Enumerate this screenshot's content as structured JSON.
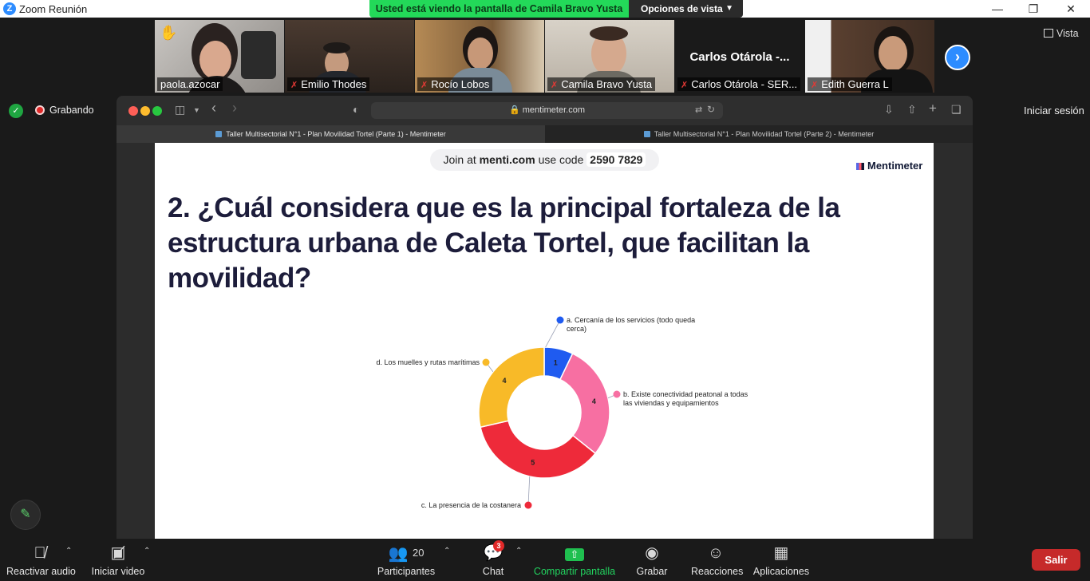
{
  "window": {
    "title": "Zoom Reunión",
    "logo_letter": "Z"
  },
  "share_banner": {
    "message": "Usted está viendo la pantalla de Camila Bravo Yusta",
    "view_options": "Opciones de vista"
  },
  "participants": [
    {
      "name": "paola.azocar",
      "muted": false,
      "hand_raised": true
    },
    {
      "name": "Emilio Thodes",
      "muted": true
    },
    {
      "name": "Rocío Lobos",
      "muted": true
    },
    {
      "name": "Camila Bravo Yusta",
      "muted": true
    },
    {
      "name": "Carlos Otárola - SER...",
      "muted": true,
      "display_name": "Carlos  Otárola  -..."
    },
    {
      "name": "Edith Guerra L",
      "muted": true
    }
  ],
  "view_label": "Vista",
  "recording_label": "Grabando",
  "signin_label": "Iniciar sesión",
  "browser": {
    "url": "mentimeter.com",
    "tabs": [
      "Taller Multisectorial N°1 - Plan Movilidad Tortel (Parte 1) - Mentimeter",
      "Taller Multisectorial N°1 - Plan Movilidad Tortel (Parte 2) - Mentimeter"
    ]
  },
  "menti": {
    "join_prefix": "Join at",
    "join_site": "menti.com",
    "join_mid": "use code",
    "join_code": "2590 7829",
    "brand": "Mentimeter",
    "question_lines": [
      "2. ¿Cuál considera que es la principal fortaleza de la",
      "estructura urbana de Caleta Tortel, que facilitan la",
      "movilidad?"
    ]
  },
  "chart_data": {
    "type": "pie",
    "donut": true,
    "categories": [
      "a. Cercanía de los servicios (todo queda cerca)",
      "b. Existe conectividad peatonal a todas las viviendas y equipamientos",
      "c. La presencia de la costanera",
      "d. Los muelles y rutas marítimas"
    ],
    "label_lines": [
      [
        "a. Cercanía de los servicios (todo queda",
        "cerca)"
      ],
      [
        "b. Existe conectividad peatonal a todas",
        "las viviendas y equipamientos"
      ],
      [
        "c. La presencia de la costanera"
      ],
      [
        "d. Los muelles y rutas marítimas"
      ]
    ],
    "values": [
      1,
      4,
      5,
      4
    ],
    "colors": [
      "#1f5bf0",
      "#f76fa2",
      "#ee2a3a",
      "#f8ba28"
    ]
  },
  "controls": {
    "audio": "Reactivar audio",
    "video": "Iniciar video",
    "participants": "Participantes",
    "participants_count": "20",
    "chat": "Chat",
    "chat_badge": "3",
    "share": "Compartir pantalla",
    "record": "Grabar",
    "reactions": "Reacciones",
    "apps": "Aplicaciones",
    "leave": "Salir"
  }
}
